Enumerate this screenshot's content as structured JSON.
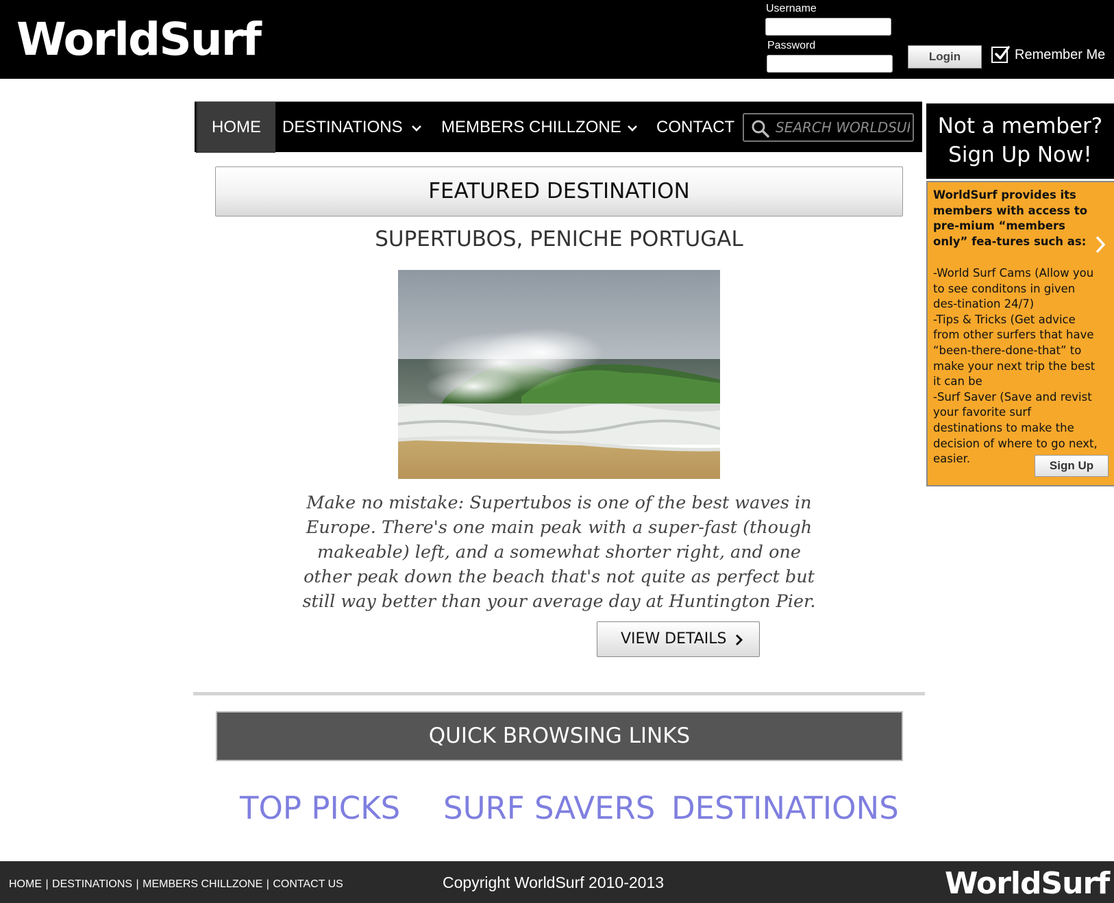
{
  "header": {
    "logo": "WorldSurf",
    "username_label": "Username",
    "password_label": "Password",
    "login_button": "Login",
    "remember_label": "Remember Me",
    "remember_checked": true
  },
  "nav": {
    "items": [
      {
        "label": "HOME",
        "active": true
      },
      {
        "label": "DESTINATIONS",
        "dropdown": true
      },
      {
        "label": "MEMBERS CHILLZONE",
        "dropdown": true
      },
      {
        "label": "CONTACT"
      }
    ],
    "search_placeholder": "SEARCH WORLDSURF"
  },
  "sidebar": {
    "heading_line1": "Not a member?",
    "heading_line2": "Sign Up Now!",
    "intro": "WorldSurf provides its members with access to pre-mium “members only” fea-tures such as:",
    "features": [
      "-World Surf Cams (Allow you to see conditons in given des-tination 24/7)",
      "-Tips & Tricks (Get advice from other surfers that have “been-there-done-that” to make your next trip the best it can be",
      "-Surf Saver (Save and revist your favorite surf destinations to make the decision of where to go next, easier."
    ],
    "signup_button": "Sign Up",
    "panel_color": "#f6a82b"
  },
  "main": {
    "featured_heading": "FEATURED DESTINATION",
    "destination_name": "SUPERTUBOS, PENICHE PORTUGAL",
    "description": "Make no mistake: Supertubos is one of the best waves in Europe. There's one main peak with a super-fast (though makeable) left, and a somewhat shorter right, and one other peak down the beach that's not quite as perfect but still way better than your average day at Huntington Pier.",
    "view_details": "VIEW DETAILS",
    "quick_heading": "QUICK BROWSING LINKS",
    "quick_links": [
      "TOP PICKS",
      "SURF SAVERS",
      "DESTINATIONS"
    ],
    "link_color": "#7f7fe0"
  },
  "footer": {
    "links": [
      "HOME",
      "DESTINATIONS",
      "MEMBERS CHILLZONE",
      "CONTACT US"
    ],
    "copyright": "Copyright WorldSurf 2010-2013",
    "logo": "WorldSurf"
  }
}
